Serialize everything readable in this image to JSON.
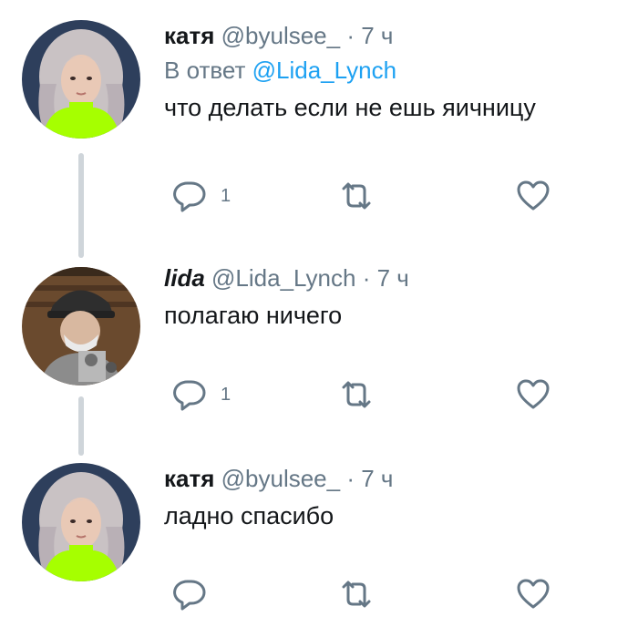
{
  "tweets": [
    {
      "name": "катя",
      "handle": "@byulsee_",
      "dot": "·",
      "time": "7 ч",
      "reply_prefix": "В ответ",
      "reply_mention": "@Lida_Lynch",
      "text": "что делать если не ешь яичницу",
      "reply_count": "1",
      "avatar": "avatar-katya"
    },
    {
      "name": "lida",
      "handle": "@Lida_Lynch",
      "dot": "·",
      "time": "7 ч",
      "text": "полагаю ничего",
      "reply_count": "1",
      "avatar": "avatar-lida"
    },
    {
      "name": "катя",
      "handle": "@byulsee_",
      "dot": "·",
      "time": "7 ч",
      "text": "ладно спасибо",
      "reply_count": "",
      "avatar": "avatar-katya"
    }
  ],
  "icons": {
    "reply": "reply-icon",
    "retweet": "retweet-icon",
    "like": "heart-icon"
  },
  "colors": {
    "text": "#14171a",
    "secondary": "#657786",
    "link": "#1da1f2",
    "thread_line": "#cfd5da",
    "neon_green": "#a6ff00"
  }
}
